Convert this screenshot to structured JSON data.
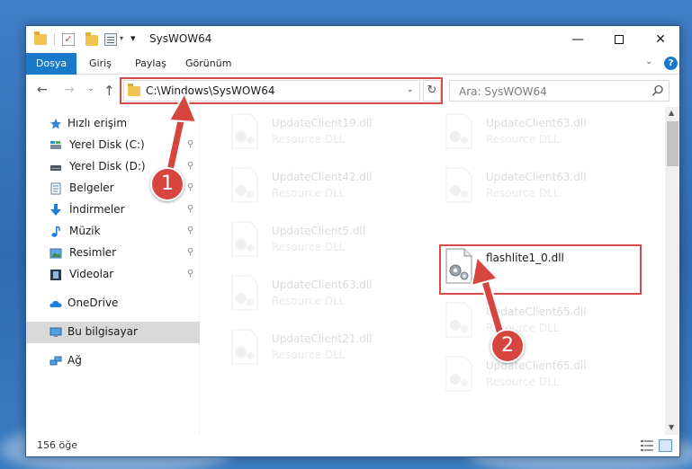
{
  "window": {
    "title": "SysWOW64",
    "controls": {
      "minimize": "—",
      "maximize": "",
      "close": "✕"
    }
  },
  "quick_access_toolbar": {
    "check_glyph": "✓",
    "dropdown_glyph": "▾",
    "pin_glyph": "▾"
  },
  "ribbon": {
    "tabs": [
      "Dosya",
      "Giriş",
      "Paylaş",
      "Görünüm"
    ],
    "collapse_glyph": "⌄",
    "help_glyph": "?"
  },
  "navigation": {
    "back_glyph": "←",
    "forward_glyph": "→",
    "recent_glyph": "⌄",
    "up_glyph": "↑",
    "address_path": "C:\\Windows\\SysWOW64",
    "address_dropdown_glyph": "⌄",
    "refresh_glyph": "↻",
    "search_placeholder": "Ara: SysWOW64"
  },
  "sidebar": {
    "quick_access_label": "Hızlı erişim",
    "pin_glyph": "📌",
    "items": [
      {
        "label": "Yerel Disk (C:)",
        "icon": "drive-icon",
        "pinned": true
      },
      {
        "label": "Yerel Disk (D:)",
        "icon": "drive-icon",
        "pinned": true
      },
      {
        "label": "Belgeler",
        "icon": "documents-icon",
        "pinned": true
      },
      {
        "label": "İndirmeler",
        "icon": "download-icon",
        "pinned": true
      },
      {
        "label": "Müzik",
        "icon": "music-icon",
        "pinned": true
      },
      {
        "label": "Resimler",
        "icon": "pictures-icon",
        "pinned": true
      },
      {
        "label": "Videolar",
        "icon": "videos-icon",
        "pinned": true
      }
    ],
    "onedrive_label": "OneDrive",
    "this_pc_label": "Bu bilgisayar",
    "network_label": "Ağ"
  },
  "files": [
    {
      "name": "UpdateClient19.dll",
      "type": "Resource DLL",
      "faded": true
    },
    {
      "name": "UpdateClient63.dll",
      "type": "Resource DLL",
      "faded": true
    },
    {
      "name": "UpdateClient42.dll",
      "type": "Resource DLL",
      "faded": true
    },
    {
      "name": "UpdateClient63.dll",
      "type": "Resource DLL",
      "faded": true
    },
    {
      "name": "UpdateClient5.dll",
      "type": "Resource DLL",
      "faded": true
    },
    {
      "name": "flashlite1_0.dll",
      "type": "",
      "faded": false
    },
    {
      "name": "UpdateClient63.dll",
      "type": "Resource DLL",
      "faded": true
    },
    {
      "name": "UpdateClient65.dll",
      "type": "Resource DLL",
      "faded": true
    },
    {
      "name": "UpdateClient21.dll",
      "type": "Resource DLL",
      "faded": true
    },
    {
      "name": "UpdateClient65.dll",
      "type": "Resource DLL",
      "faded": true
    }
  ],
  "scrollbar": {
    "up_glyph": "▲",
    "down_glyph": "▼"
  },
  "status": {
    "item_count": "156 öğe"
  },
  "annotations": {
    "callout_1": "1",
    "callout_2": "2",
    "color": "#d6463f"
  },
  "colors": {
    "accent": "#1979ca",
    "highlight": "#d84a4a",
    "selected": "#d9d9d9"
  }
}
